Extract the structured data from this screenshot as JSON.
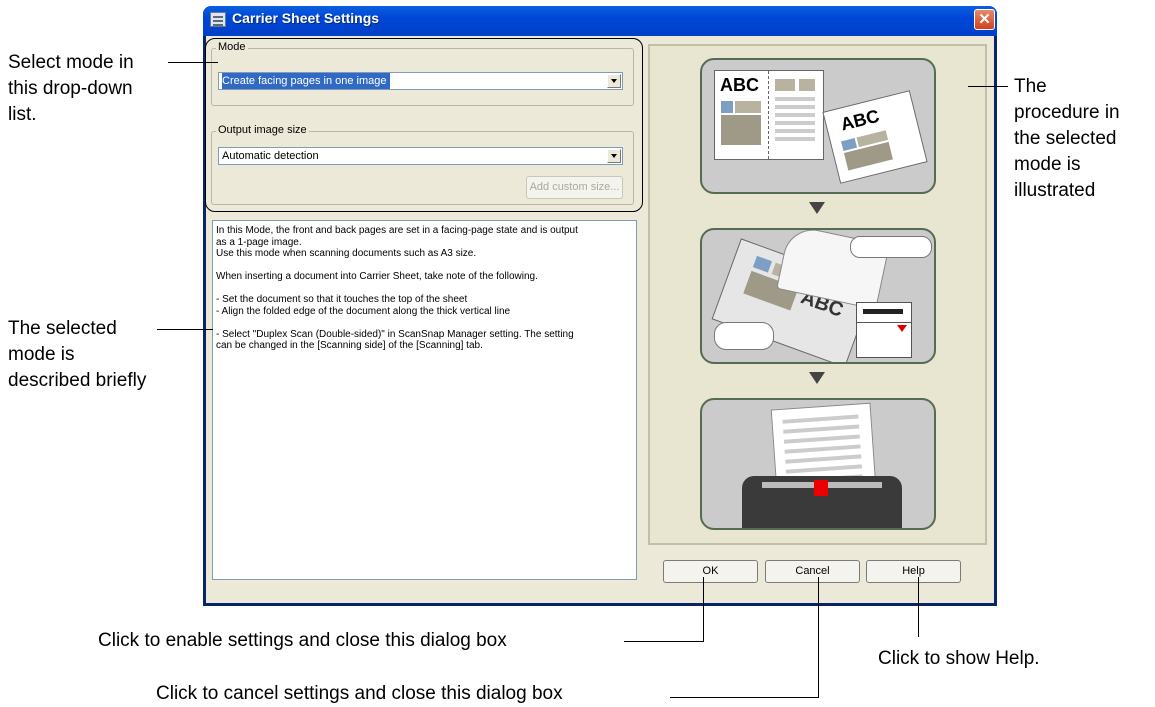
{
  "dialog": {
    "title": "Carrier Sheet Settings",
    "close_glyph": "✕",
    "mode_group": {
      "label": "Mode",
      "selected": "Create facing pages in one image"
    },
    "output_group": {
      "label": "Output image size",
      "selected": "Automatic detection",
      "add_custom_size_label": "Add custom size..."
    },
    "description": "In this Mode, the front and back pages are set in a facing-page state and is output\nas a 1-page image.\nUse this mode when scanning documents such as A3 size.\n\nWhen inserting a document into Carrier Sheet, take note of the following.\n\n- Set the document so that it touches the top of the sheet\n- Align the folded edge of the document along the thick vertical line\n\n- Select \"Duplex Scan (Double-sided)\" in ScanSnap Manager setting. The setting\ncan be changed in the [Scanning side] of the [Scanning] tab.",
    "buttons": {
      "ok": "OK",
      "cancel": "Cancel",
      "help": "Help"
    },
    "illustration": {
      "card1_text_a": "ABC",
      "card1_text_b": "ABC",
      "card2_text": "ABC"
    }
  },
  "callouts": {
    "mode_dropdown": "Select mode in\nthis drop-down\nlist.",
    "description": "The selected\nmode is\ndescribed briefly",
    "illustration": "The\nprocedure in\nthe selected\nmode is\nillustrated",
    "ok": "Click to enable settings and close this dialog box",
    "cancel": "Click to cancel settings and close this dialog box",
    "help": "Click to show Help."
  },
  "colors": {
    "titlebar": "#0046d6",
    "dialog_bg": "#ece9d8",
    "selection": "#316ac5",
    "close_button": "#d3401d"
  },
  "icons": [
    "dialog-icon",
    "close-icon",
    "dropdown-arrow-icon"
  ]
}
